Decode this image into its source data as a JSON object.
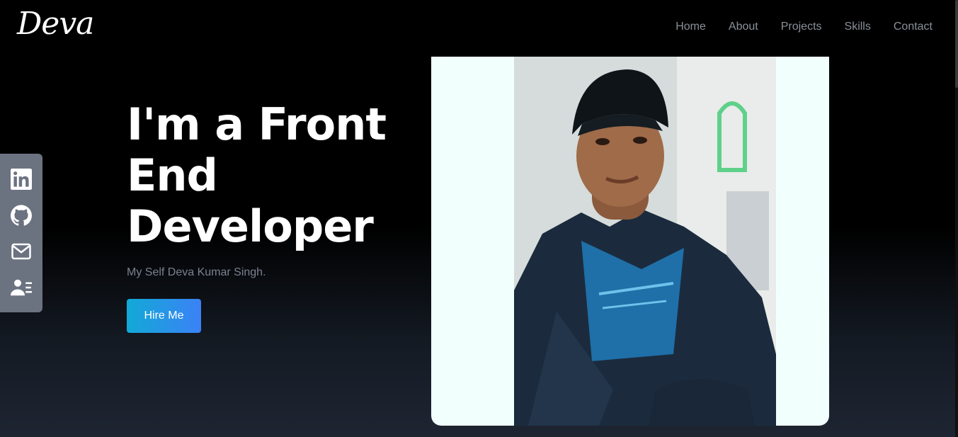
{
  "brand": {
    "logo_text": "Deva"
  },
  "nav": {
    "items": [
      "Home",
      "About",
      "Projects",
      "Skills",
      "Contact"
    ]
  },
  "social": {
    "items": [
      {
        "name": "linkedin",
        "icon": "linkedin-icon"
      },
      {
        "name": "github",
        "icon": "github-icon"
      },
      {
        "name": "email",
        "icon": "mail-icon"
      },
      {
        "name": "resume",
        "icon": "person-card-icon"
      }
    ]
  },
  "hero": {
    "title": "I'm a Front End Developer",
    "subtitle": "My Self Deva Kumar Singh.",
    "cta_label": "Hire Me"
  },
  "colors": {
    "accent_start": "#12a9d6",
    "accent_end": "#3b82f6",
    "nav_text": "#8a9099",
    "social_bar": "#6b7280",
    "card_bg": "#f1fffd"
  }
}
